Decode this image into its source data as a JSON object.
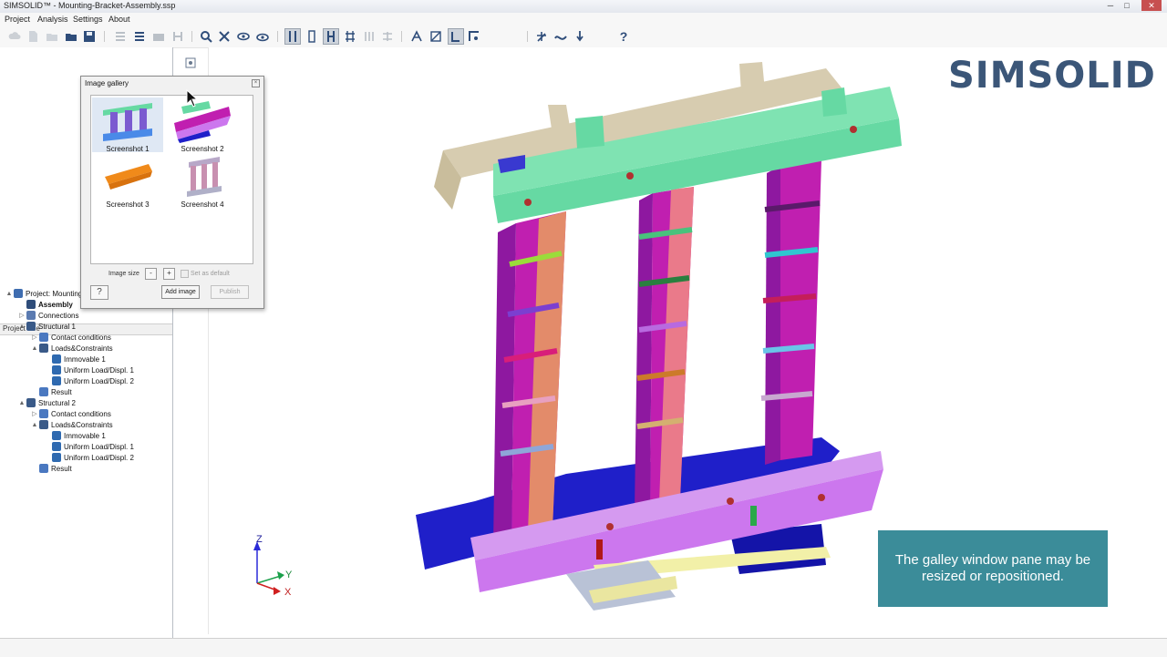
{
  "window": {
    "title": "SIMSOLID™ - Mounting-Bracket-Assembly.ssp",
    "min": "─",
    "max": "□",
    "close": "✕"
  },
  "menu": [
    "Project",
    "Analysis",
    "Settings",
    "About"
  ],
  "toolbar": {
    "help_label": "?"
  },
  "brand_logo": "SIMSOLID",
  "project_tree": {
    "header": "Project tree",
    "rows": [
      {
        "label": "Project: Mounting",
        "twist": "▲",
        "icon": "project-icon"
      },
      {
        "label": "Assembly",
        "twist": "",
        "icon": "assembly-icon"
      },
      {
        "label": "Connections",
        "twist": "▷",
        "icon": "connections-icon"
      },
      {
        "label": "Structural 1",
        "twist": "▲",
        "icon": "structural-icon"
      },
      {
        "label": "Contact conditions",
        "twist": "▷",
        "icon": "contact-icon"
      },
      {
        "label": "Loads&Constraints",
        "twist": "▲",
        "icon": "loads-icon"
      },
      {
        "label": "Immovable 1",
        "twist": "",
        "icon": "immovable-icon"
      },
      {
        "label": "Uniform Load/Displ. 1",
        "twist": "",
        "icon": "load-icon"
      },
      {
        "label": "Uniform Load/Displ. 2",
        "twist": "",
        "icon": "load-icon"
      },
      {
        "label": "Result",
        "twist": "",
        "icon": "result-icon"
      },
      {
        "label": "Structural 2",
        "twist": "▲",
        "icon": "structural-icon"
      },
      {
        "label": "Contact conditions",
        "twist": "▷",
        "icon": "contact-icon"
      },
      {
        "label": "Loads&Constraints",
        "twist": "▲",
        "icon": "loads-icon"
      },
      {
        "label": "Immovable 1",
        "twist": "",
        "icon": "immovable-icon"
      },
      {
        "label": "Uniform Load/Displ. 1",
        "twist": "",
        "icon": "load-icon"
      },
      {
        "label": "Uniform Load/Displ. 2",
        "twist": "",
        "icon": "load-icon"
      },
      {
        "label": "Result",
        "twist": "",
        "icon": "result-icon"
      }
    ]
  },
  "gallery": {
    "title": "Image gallery",
    "close": "×",
    "items": [
      "Screenshot 1",
      "Screenshot 2",
      "Screenshot 3",
      "Screenshot 4"
    ],
    "selected": "Screenshot 1",
    "image_size_label": "Image size",
    "minus": "-",
    "plus": "+",
    "set_default": "Set as default",
    "help": "?",
    "add_image": "Add image",
    "publish": "Publish"
  },
  "axes": {
    "z": "Z",
    "y": "Y",
    "x": "X"
  },
  "callout": "The galley window pane may be resized or repositioned.",
  "colors": {
    "callout_bg": "#3b8c99",
    "logo": "#3b5678",
    "top_beam": "#66d9a3",
    "back_beam": "#d7ccb0",
    "columns": "#c01fb0",
    "column_face": "#e38b6a",
    "base_beam": "#cc77ee",
    "base_plate": "#1f1fc9"
  }
}
